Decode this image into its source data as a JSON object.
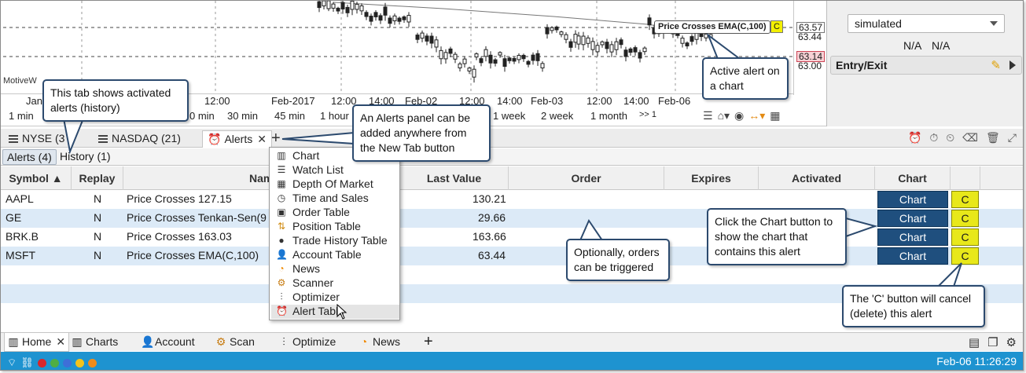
{
  "chart": {
    "watermark": "MotiveW",
    "price_labels": [
      "63.57",
      "63.44",
      "63.14",
      "63.00"
    ],
    "time_ticks": [
      "Jan",
      "12:00",
      "Feb-2017",
      "12:00",
      "14:00",
      "Feb-02",
      "12:00",
      "14:00",
      "Feb-03",
      "12:00",
      "14:00",
      "Feb-06"
    ],
    "bar_options": [
      "1 min",
      "0 min",
      "30 min",
      "45 min",
      "1 hour",
      "1 week",
      "2 week",
      "1 month",
      ">> 1"
    ],
    "alert_tag": "Price Crosses EMA(C,100)",
    "alert_tag_button": "C"
  },
  "right_panel": {
    "account_select": "simulated",
    "na_1": "N/A",
    "na_2": "N/A",
    "entry_exit": "Entry/Exit"
  },
  "tabs": [
    {
      "label": "NYSE (3"
    },
    {
      "label": "NASDAQ (21)"
    },
    {
      "label": "Alerts"
    }
  ],
  "subtabs": [
    {
      "label": "Alerts (4)"
    },
    {
      "label": "History (1)"
    }
  ],
  "table": {
    "headers": [
      "Symbol ▲",
      "Replay",
      "Nam",
      "Last Value",
      "Order",
      "Expires",
      "Activated",
      "Chart"
    ],
    "rows": [
      {
        "symbol": "AAPL",
        "replay": "N",
        "name": "Price Crosses 127.15",
        "last": "130.21",
        "chart": "Chart",
        "cancel": "C"
      },
      {
        "symbol": "GE",
        "replay": "N",
        "name": "Price Crosses Tenkan-Sen(9",
        "last": "29.66",
        "chart": "Chart",
        "cancel": "C"
      },
      {
        "symbol": "BRK.B",
        "replay": "N",
        "name": "Price Crosses 163.03",
        "last": "163.66",
        "chart": "Chart",
        "cancel": "C"
      },
      {
        "symbol": "MSFT",
        "replay": "N",
        "name": "Price Crosses EMA(C,100)",
        "last": "63.44",
        "chart": "Chart",
        "cancel": "C"
      }
    ]
  },
  "menu": {
    "items": [
      {
        "label": "Chart",
        "icon": "bar-chart-icon"
      },
      {
        "label": "Watch List",
        "icon": "list-icon"
      },
      {
        "label": "Depth Of Market",
        "icon": "dom-icon"
      },
      {
        "label": "Time and Sales",
        "icon": "clock-icon"
      },
      {
        "label": "Order Table",
        "icon": "order-icon"
      },
      {
        "label": "Position Table",
        "icon": "position-icon"
      },
      {
        "label": "Trade History Table",
        "icon": "trade-history-icon"
      },
      {
        "label": "Account Table",
        "icon": "account-icon"
      },
      {
        "label": "News",
        "icon": "rss-icon"
      },
      {
        "label": "Scanner",
        "icon": "scanner-icon"
      },
      {
        "label": "Optimizer",
        "icon": "optimizer-icon"
      },
      {
        "label": "Alert Table",
        "icon": "alarm-icon"
      }
    ]
  },
  "nav": {
    "items": [
      {
        "label": "Home"
      },
      {
        "label": "Charts"
      },
      {
        "label": "Account"
      },
      {
        "label": "Scan"
      },
      {
        "label": "Optimize"
      },
      {
        "label": "News"
      }
    ],
    "add": "+"
  },
  "status": {
    "datetime": "Feb-06 11:26:29",
    "dot_colors": [
      "#d9262b",
      "#4fae44",
      "#3e6fd8",
      "#f2c31b",
      "#f08b1b"
    ]
  },
  "callouts": {
    "history": "This tab shows activated alerts (history)",
    "new_tab": "An Alerts panel can be added anywhere from the New Tab button",
    "active_alert": "Active alert on a chart",
    "chart_button": "Click the Chart button to show the chart that contains this alert",
    "orders": "Optionally, orders can be triggered",
    "cancel": "The 'C' button will cancel (delete) this alert"
  },
  "colors": {
    "accent": "#1e93d0",
    "chart_button": "#1f4f7e",
    "cancel_button": "#e8e81a",
    "row_alt": "#dceaf7"
  }
}
